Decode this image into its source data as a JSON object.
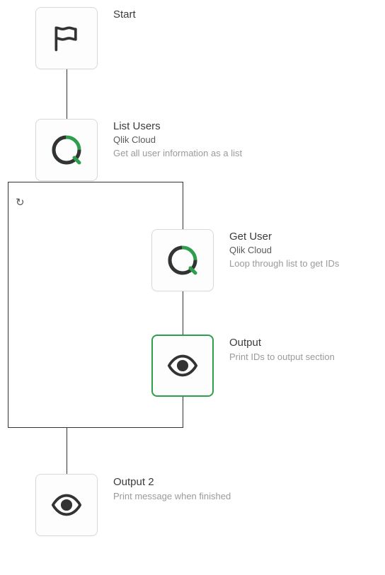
{
  "nodes": {
    "start": {
      "title": "Start"
    },
    "listUsers": {
      "title": "List Users",
      "subtitle": "Qlik Cloud",
      "desc": "Get all user information as a list"
    },
    "getUser": {
      "title": "Get User",
      "subtitle": "Qlik Cloud",
      "desc": "Loop through list to get IDs"
    },
    "output": {
      "title": "Output",
      "desc": "Print IDs to output section"
    },
    "output2": {
      "title": "Output 2",
      "desc": "Print message when finished"
    }
  }
}
